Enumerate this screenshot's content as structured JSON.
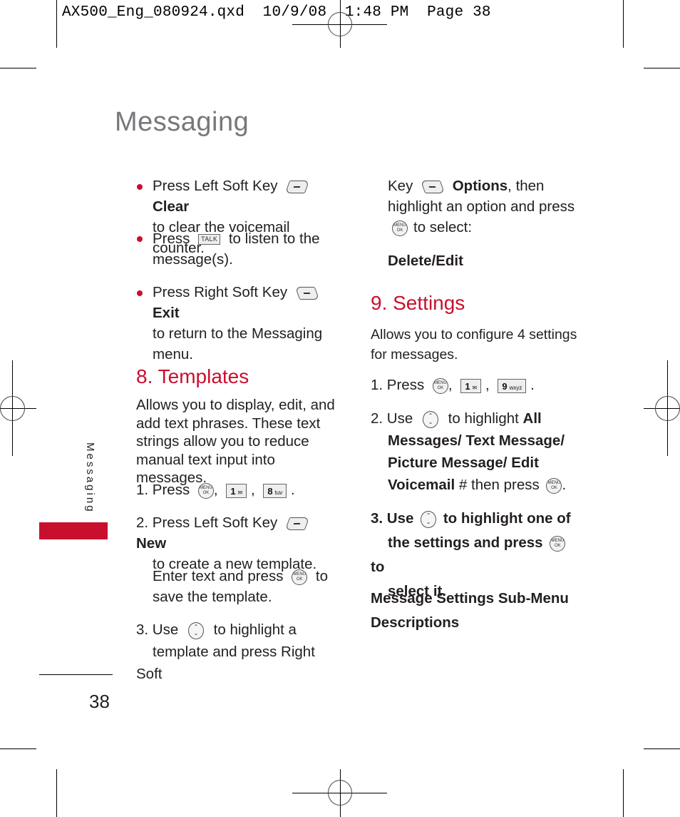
{
  "slug": "AX500_Eng_080924.qxd  10/9/08  1:48 PM  Page 38",
  "page_title": "Messaging",
  "side_tab_label": "Messaging",
  "page_number": "38",
  "colors": {
    "accent": "#c8102e",
    "title_gray": "#77787b",
    "body": "#231f20"
  },
  "icons": {
    "left_soft_key": "left-soft-key-icon",
    "right_soft_key": "right-soft-key-icon",
    "talk": "TALK",
    "menu_ok": [
      "MENU",
      "OK"
    ],
    "nav": "navigation-key-icon",
    "key_1": {
      "digit": "1",
      "sub": "voicemail"
    },
    "key_8": {
      "digit": "8",
      "sub": "tuv"
    },
    "key_9": {
      "digit": "9",
      "sub": "wxyz"
    }
  },
  "left_column": {
    "bullets": [
      {
        "pre": "Press Left Soft Key",
        "bold": "Clear",
        "post": "to clear the voicemail counter."
      },
      {
        "pre": "Press",
        "post1": "to listen to the",
        "post2": "message(s)."
      },
      {
        "pre": "Press Right Soft Key",
        "bold": "Exit",
        "post": "to return to the Messaging",
        "post2": "menu."
      }
    ],
    "templates": {
      "title": "8. Templates",
      "desc": [
        "Allows you to display, edit, and",
        "add text phrases. These text",
        "strings allow you to reduce",
        "manual text input into messages."
      ],
      "step1_pre": "1. Press",
      "step2_pre": "2. Press Left Soft Key",
      "step2_bold": "New",
      "step2_post": "to create a new template.",
      "step2_enter": "Enter text and press",
      "step2_enter_post": "to",
      "step2_enter_line2": "save the template.",
      "step3_pre": "3. Use",
      "step3_post": "to highlight a",
      "step3_line2": "template and press Right Soft"
    }
  },
  "right_column": {
    "cont_pre": "Key",
    "cont_bold": "Options",
    "cont_post": ", then",
    "cont_line2": "highlight an option and press",
    "cont_line3": "to select:",
    "option": "Delete/Edit",
    "settings": {
      "title": "9. Settings",
      "desc": [
        "Allows you to configure 4 settings",
        "for messages."
      ],
      "step1_pre": "1. Press",
      "step2_pre": "2. Use",
      "step2_mid": "to highlight",
      "step2_bold1": "All",
      "step2_line2": "Messages/ Text Message/",
      "step2_line3": "Picture Message/ Edit",
      "step2_line4_bold": "Voicemail",
      "step2_line4_post": "# then press",
      "step3_pre": "3. Use",
      "step3_post": "to highlight one of",
      "step3_line2": "the settings and press",
      "step3_line2_post": "to",
      "step3_line3": "select it.",
      "submenu_heading": [
        "Message Settings Sub-Menu",
        "Descriptions"
      ]
    }
  },
  "punct": {
    "comma": ",",
    "period": "."
  }
}
